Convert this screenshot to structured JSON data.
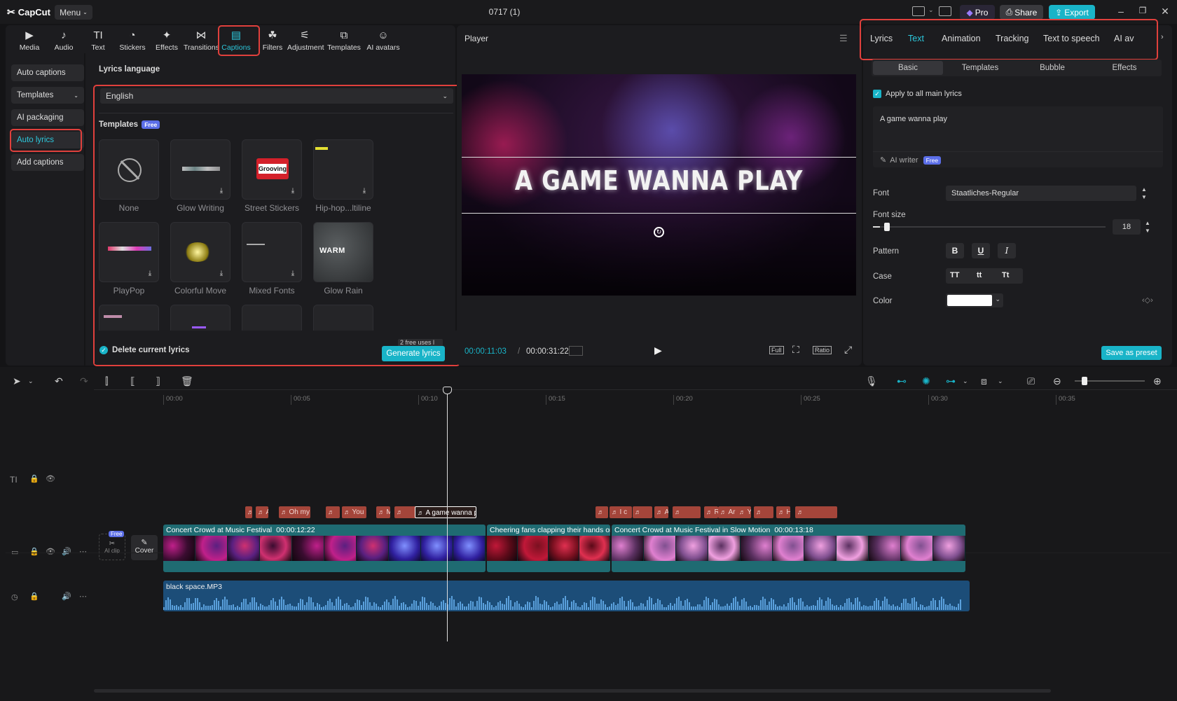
{
  "app": {
    "logo": "CapCut",
    "menu": "Menu",
    "title": "0717 (1)",
    "pro": "Pro",
    "share": "Share",
    "export": "Export"
  },
  "toolbar": [
    {
      "label": "Media",
      "icon": "▶"
    },
    {
      "label": "Audio",
      "icon": "♪"
    },
    {
      "label": "Text",
      "icon": "TI"
    },
    {
      "label": "Stickers",
      "icon": "◔"
    },
    {
      "label": "Effects",
      "icon": "✦"
    },
    {
      "label": "Transitions",
      "icon": "⋈"
    },
    {
      "label": "Captions",
      "icon": "▤"
    },
    {
      "label": "Filters",
      "icon": "☘"
    },
    {
      "label": "Adjustment",
      "icon": "⚟"
    },
    {
      "label": "Templates",
      "icon": "⧉"
    },
    {
      "label": "AI avatars",
      "icon": "☺"
    }
  ],
  "sidebar": [
    "Auto captions",
    "Templates",
    "AI packaging",
    "Auto lyrics",
    "Add captions"
  ],
  "lyrics": {
    "language_label": "Lyrics language",
    "language": "English",
    "templates_label": "Templates",
    "free": "Free",
    "templates": [
      "None",
      "Glow Writing",
      "Street Stickers",
      "Hip-hop...ltiline",
      "PlayPop",
      "Colorful Move",
      "Mixed Fonts",
      "Glow Rain"
    ],
    "delete_label": "Delete current lyrics",
    "free_uses": "2 free uses l",
    "generate": "Generate lyrics"
  },
  "player": {
    "title": "Player",
    "overlay_text": "A GAME WANNA PLAY",
    "current_time": "00:00:11:03",
    "total_time": "00:00:31:22",
    "full": "Full",
    "ratio": "Ratio"
  },
  "right": {
    "tabs": [
      "Lyrics",
      "Text",
      "Animation",
      "Tracking",
      "Text to speech",
      "AI av"
    ],
    "subtabs": [
      "Basic",
      "Templates",
      "Bubble",
      "Effects"
    ],
    "apply_all": "Apply to all main lyrics",
    "text_value": "A game wanna play",
    "ai_writer": "AI writer",
    "font_label": "Font",
    "font_value": "Staatliches-Regular",
    "size_label": "Font size",
    "size_value": "18",
    "pattern_label": "Pattern",
    "case_label": "Case",
    "case_options": [
      "TT",
      "tt",
      "Tt"
    ],
    "color_label": "Color",
    "save_preset": "Save as preset",
    "font_size_fraction": 0.03
  },
  "timeline": {
    "ticks": [
      "00:00",
      "00:05",
      "00:10",
      "00:15",
      "00:20",
      "00:25",
      "00:30",
      "00:35"
    ],
    "captions": [
      "A",
      "Oh my g",
      "You",
      "My ne",
      "A game wanna play",
      "I c",
      "A",
      "Rumo",
      "Ar",
      "You",
      "Hey let"
    ],
    "clips": [
      {
        "name": "Concert Crowd at Music Festival",
        "duration": "00:00:12:22"
      },
      {
        "name": "Cheering fans clapping their hands on t",
        "duration": ""
      },
      {
        "name": "Concert Crowd at Music Festival in Slow Motion",
        "duration": "00:00:13:18"
      }
    ],
    "cover": "Cover",
    "ai_clip": "AI clip",
    "audio": "black space.MP3"
  }
}
